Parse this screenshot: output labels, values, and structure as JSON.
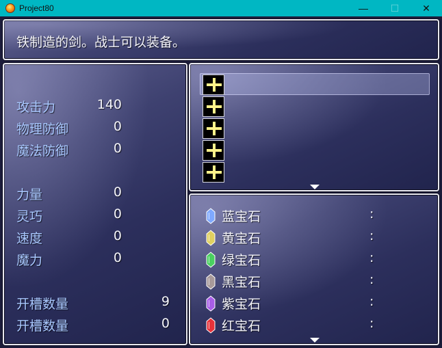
{
  "window": {
    "title": "Project80",
    "minimize_icon": "minimize-icon",
    "maximize_icon": "maximize-icon",
    "close_icon": "close-icon",
    "minimize_glyph": "—",
    "maximize_glyph": "☐",
    "close_glyph": "✕"
  },
  "description": "铁制造的剑。战士可以装备。",
  "stats": [
    {
      "label": "攻击力",
      "value": "140"
    },
    {
      "label": "物理防御",
      "value": "0"
    },
    {
      "label": "魔法防御",
      "value": "0"
    },
    {
      "label": "力量",
      "value": "0"
    },
    {
      "label": "灵巧",
      "value": "0"
    },
    {
      "label": "速度",
      "value": "0"
    },
    {
      "label": "魔力",
      "value": "0"
    },
    {
      "label": "开槽数量",
      "value": "9"
    },
    {
      "label": "开槽数量",
      "value": "0"
    }
  ],
  "slots": {
    "count": 5,
    "icon": "plus-icon",
    "selected_index": 0,
    "more_indicator": "arrow-down-icon"
  },
  "gems": [
    {
      "name": "蓝宝石",
      "colon": ":",
      "color": "#7fa9ff"
    },
    {
      "name": "黄宝石",
      "colon": ":",
      "color": "#e0d060"
    },
    {
      "name": "绿宝石",
      "colon": ":",
      "color": "#4ad060"
    },
    {
      "name": "黑宝石",
      "colon": ":",
      "color": "#a89a9a"
    },
    {
      "name": "紫宝石",
      "colon": ":",
      "color": "#a85ee8"
    },
    {
      "name": "红宝石",
      "colon": ":",
      "color": "#e8323a"
    }
  ]
}
